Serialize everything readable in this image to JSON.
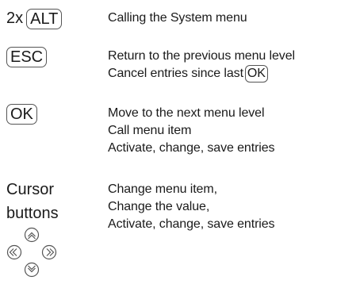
{
  "rows": [
    {
      "prefix": "2x",
      "key": "ALT",
      "lines": [
        "Calling the System menu"
      ]
    },
    {
      "key": "ESC",
      "lines": [
        "Return to the previous menu level",
        "Cancel entries since last"
      ],
      "inline_key": "OK"
    },
    {
      "key": "OK",
      "lines": [
        "Move to the next menu level",
        "Call menu item",
        "Activate, change, save entries"
      ]
    },
    {
      "key_lines": [
        "Cursor",
        "buttons"
      ],
      "lines": [
        "Change menu item,",
        "Change the value,",
        "Activate, change, save entries"
      ],
      "icons": [
        "up-arrow-icon",
        "left-arrow-icon",
        "right-arrow-icon",
        "down-arrow-icon"
      ]
    }
  ]
}
